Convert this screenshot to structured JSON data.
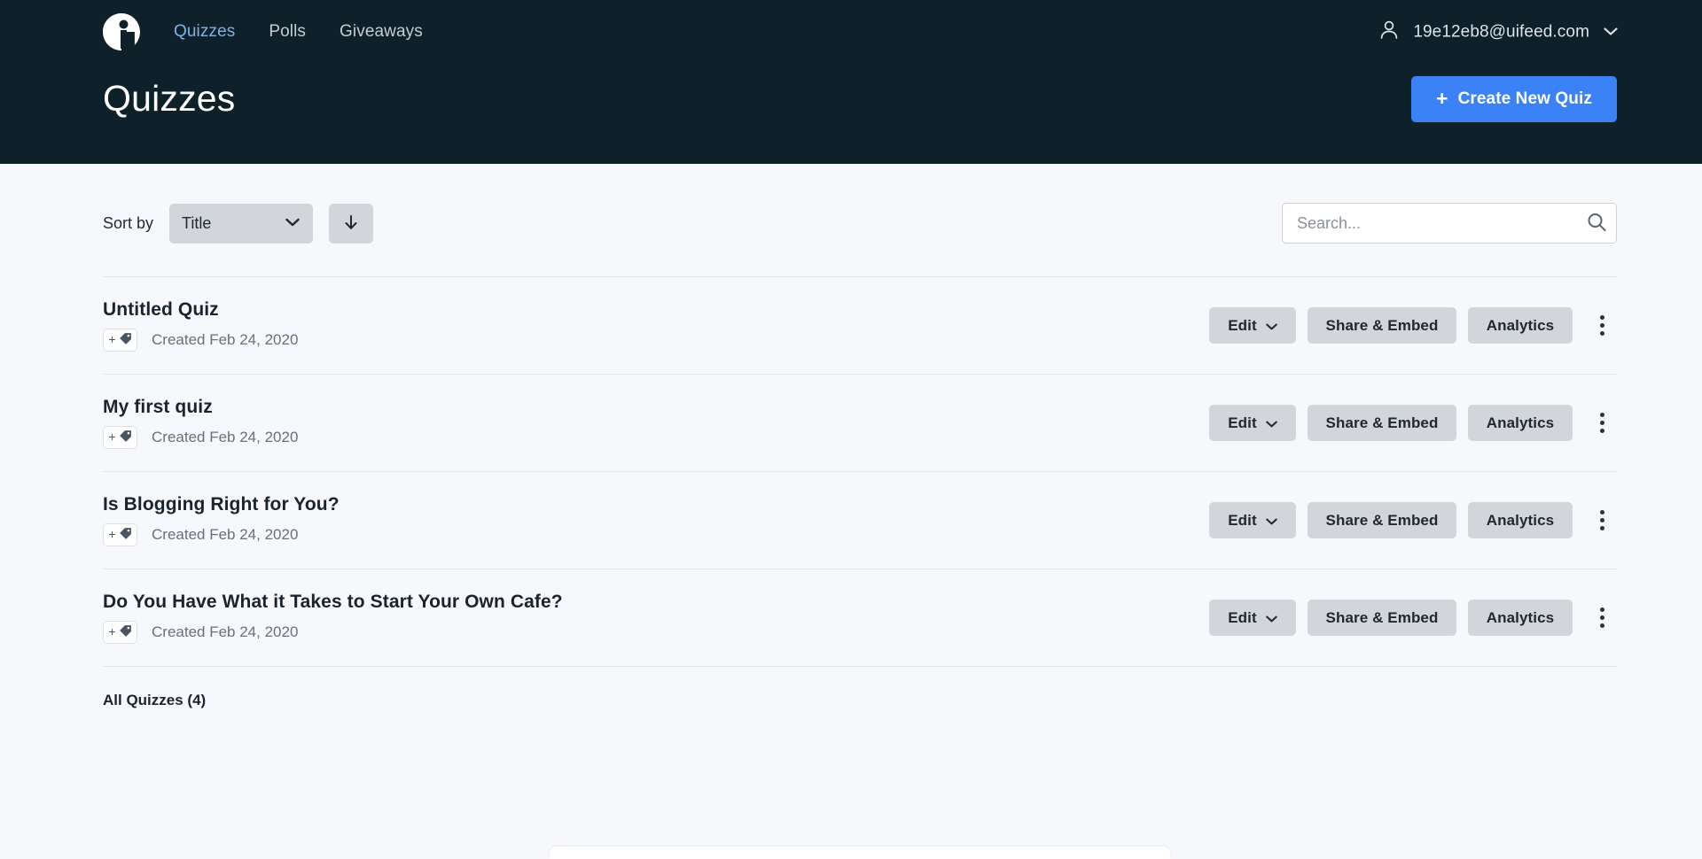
{
  "header": {
    "logo_icon": "quiz-logo-icon",
    "nav": [
      {
        "label": "Quizzes",
        "active": true
      },
      {
        "label": "Polls",
        "active": false
      },
      {
        "label": "Giveaways",
        "active": false
      }
    ],
    "account": {
      "icon": "user-icon",
      "email": "19e12eb8@uifeed.com",
      "chevron_icon": "chevron-down-icon"
    },
    "page_title": "Quizzes",
    "create_button": {
      "plus": "+",
      "label": "Create New Quiz",
      "color": "#3b82f6"
    },
    "background_color": "#0e2029"
  },
  "controls": {
    "sort_label": "Sort by",
    "sort_value": "Title",
    "sort_options": [
      "Title"
    ],
    "sort_chevron_icon": "chevron-down-icon",
    "sort_direction_icon": "arrow-down-icon",
    "search_placeholder": "Search...",
    "search_value": "",
    "search_icon": "search-icon"
  },
  "list": {
    "action_labels": {
      "edit": "Edit",
      "share": "Share & Embed",
      "analytics": "Analytics"
    },
    "tag_plus": "+",
    "tag_icon": "tag-icon",
    "kebab_icon": "more-vertical-icon",
    "rows": [
      {
        "title": "Untitled Quiz",
        "created": "Created Feb 24, 2020"
      },
      {
        "title": "My first quiz",
        "created": "Created Feb 24, 2020"
      },
      {
        "title": "Is Blogging Right for You?",
        "created": "Created Feb 24, 2020"
      },
      {
        "title": "Do You Have What it Takes to Start Your Own Cafe?",
        "created": "Created Feb 24, 2020"
      }
    ],
    "footer": "All Quizzes (4)"
  }
}
